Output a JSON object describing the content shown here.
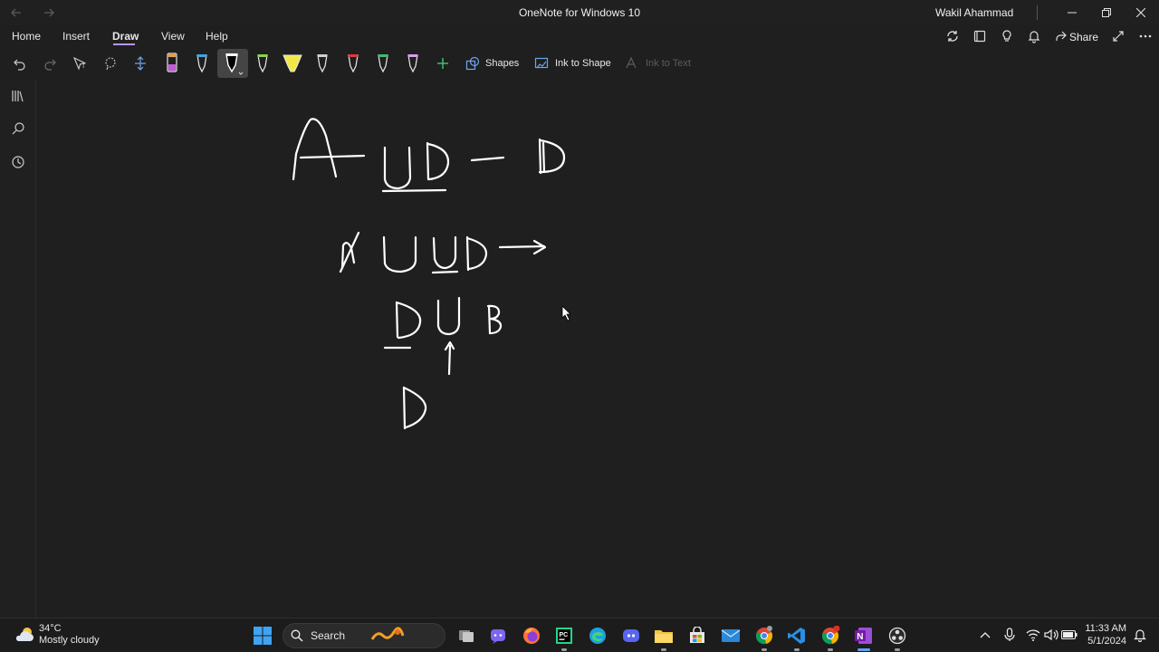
{
  "window": {
    "title": "OneNote for Windows 10",
    "user": "Wakil Ahammad"
  },
  "ribbon": {
    "tabs": [
      "Home",
      "Insert",
      "Draw",
      "View",
      "Help"
    ],
    "active_tab": "Draw",
    "share_label": "Share"
  },
  "draw_tools": {
    "shapes_label": "Shapes",
    "ink_to_shape_label": "Ink to Shape",
    "ink_to_text_label": "Ink to Text",
    "pen_colors": [
      "#c45ad8",
      "#ffffff",
      "#ffffff",
      "#8ed04b",
      "#f2e84a",
      "#d0d0d0",
      "#e0383c",
      "#3fbf6a",
      "#d7a0ef"
    ]
  },
  "left_rail": {
    "icons": [
      "notebooks-icon",
      "search-icon",
      "recent-icon"
    ]
  },
  "taskbar": {
    "weather_temp": "34°C",
    "weather_desc": "Mostly cloudy",
    "search_label": "Search",
    "time": "11:33 AM",
    "date": "5/1/2024"
  },
  "colors": {
    "background": "#1f1f1f",
    "accent": "#b695f8",
    "ink": "#ffffff"
  }
}
